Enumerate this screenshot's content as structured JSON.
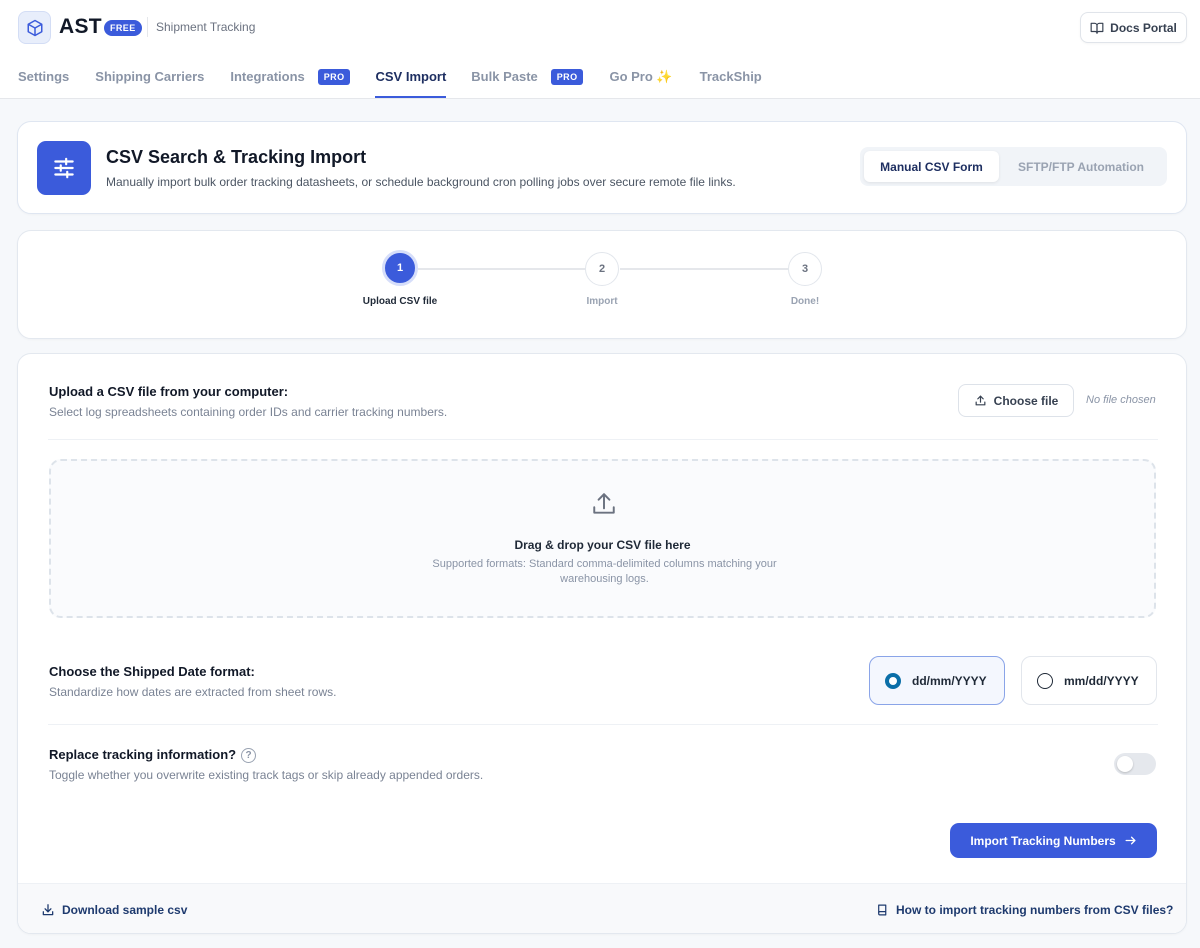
{
  "header": {
    "brand": "AST",
    "plan_badge": "FREE",
    "subtitle": "Shipment Tracking",
    "docs_label": "Docs Portal"
  },
  "tabs": [
    {
      "label": "Settings",
      "badge": ""
    },
    {
      "label": "Shipping Carriers",
      "badge": ""
    },
    {
      "label": "Integrations",
      "badge": "PRO"
    },
    {
      "label": "CSV Import",
      "badge": "",
      "active": true
    },
    {
      "label": "Bulk Paste",
      "badge": "PRO"
    },
    {
      "label": "Go Pro ✨",
      "badge": ""
    },
    {
      "label": "TrackShip",
      "badge": ""
    }
  ],
  "hero": {
    "title": "CSV Search & Tracking Import",
    "description": "Manually import bulk order tracking datasheets, or schedule background cron polling jobs over secure remote file links.",
    "mode_manual": "Manual CSV Form",
    "mode_sftp": "SFTP/FTP Automation"
  },
  "steps": [
    {
      "number": "1",
      "label": "Upload CSV file",
      "active": true
    },
    {
      "number": "2",
      "label": "Import",
      "active": false
    },
    {
      "number": "3",
      "label": "Done!",
      "active": false
    }
  ],
  "upload": {
    "title": "Upload a CSV file from your computer:",
    "description": "Select log spreadsheets containing order IDs and carrier tracking numbers.",
    "choose_label": "Choose file",
    "file_status": "No file chosen",
    "drop_title": "Drag & drop your CSV file here",
    "drop_desc": "Supported formats: Standard comma-delimited columns matching your warehousing logs."
  },
  "date_format": {
    "title": "Choose the Shipped Date format:",
    "description": "Standardize how dates are extracted from sheet rows.",
    "options": [
      "dd/mm/YYYY",
      "mm/dd/YYYY"
    ],
    "selected": "dd/mm/YYYY"
  },
  "replace": {
    "title": "Replace tracking information?",
    "help_glyph": "?",
    "description": "Toggle whether you overwrite existing track tags or skip already appended orders.",
    "enabled": false
  },
  "actions": {
    "import_label": "Import Tracking Numbers"
  },
  "footer": {
    "download_label": "Download sample csv",
    "howto_label": "How to import tracking numbers from CSV files?"
  },
  "colors": {
    "accent": "#3b5bdb",
    "radio_selected": "#0b6fa8"
  }
}
